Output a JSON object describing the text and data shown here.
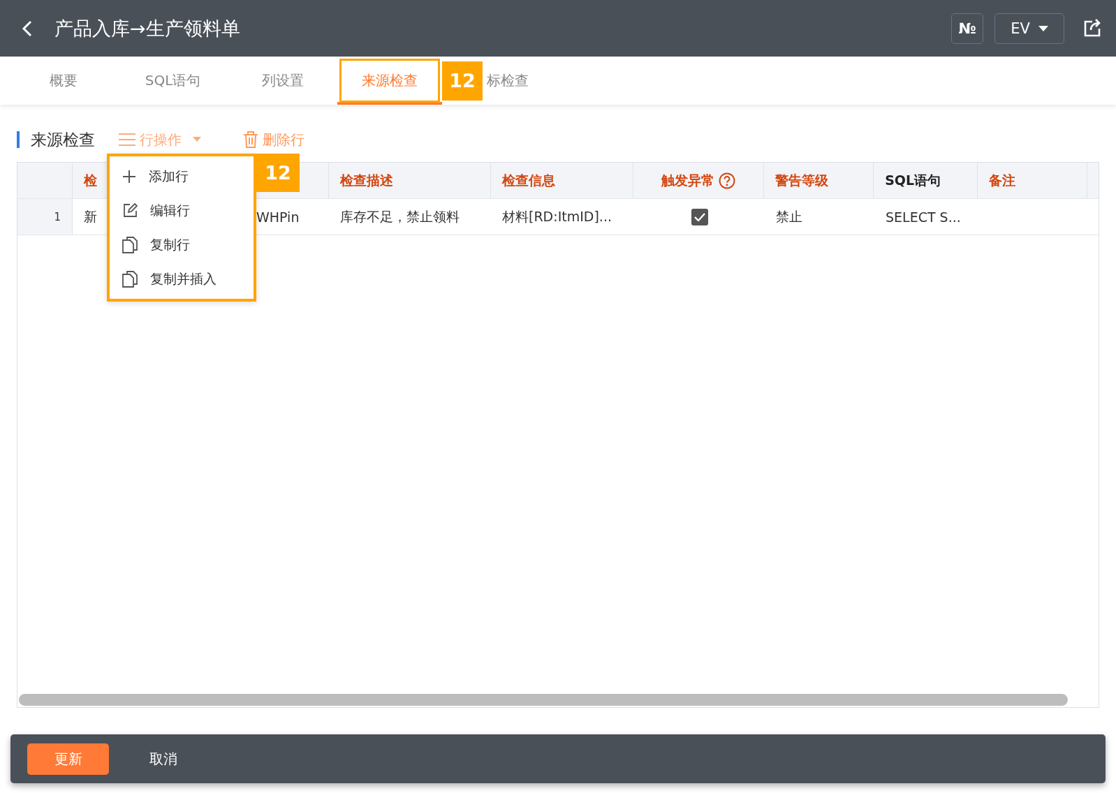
{
  "header": {
    "title": "产品入库→生产领料单",
    "number_button": "№",
    "language": "EV"
  },
  "tabs": [
    {
      "label": "概要",
      "selected": false
    },
    {
      "label": "SQL语句",
      "selected": false
    },
    {
      "label": "列设置",
      "selected": false
    },
    {
      "label": "来源检查",
      "selected": true,
      "callout": "12"
    },
    {
      "label": "标检查",
      "selected": false
    }
  ],
  "section": {
    "title": "来源检查",
    "row_actions": "行操作",
    "delete_row": "删除行"
  },
  "row_menu": {
    "callout": "12",
    "items": [
      {
        "kind": "add",
        "label": "添加行"
      },
      {
        "kind": "edit",
        "label": "编辑行"
      },
      {
        "kind": "copy",
        "label": "复制行"
      },
      {
        "kind": "copy",
        "label": "复制并插入"
      }
    ]
  },
  "table": {
    "columns": [
      {
        "label": "检",
        "required": true
      },
      {},
      {
        "label": "检查描述",
        "required": true
      },
      {
        "label": "检查信息",
        "required": true
      },
      {
        "label": "触发异常",
        "required": true,
        "help": true
      },
      {
        "label": "警告等级",
        "required": true
      },
      {
        "label": "SQL语句",
        "required": false
      },
      {
        "label": "备注",
        "required": true
      }
    ],
    "rows": [
      {
        "index": "1",
        "cells": [
          "新",
          "WHPin",
          "库存不足，禁止领料",
          "材料[RD:ItmID]...",
          {
            "checked": true
          },
          "禁止",
          "SELECT S..."
        ]
      }
    ]
  },
  "footer": {
    "update": "更新",
    "cancel": "取消"
  }
}
